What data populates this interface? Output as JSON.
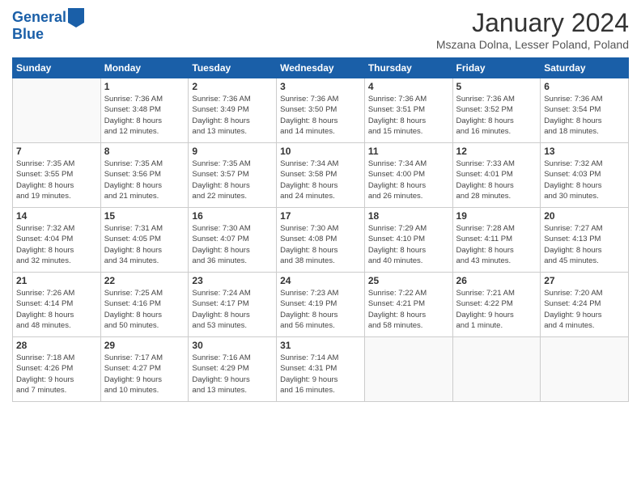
{
  "header": {
    "logo_line1": "General",
    "logo_line2": "Blue",
    "title": "January 2024",
    "location": "Mszana Dolna, Lesser Poland, Poland"
  },
  "weekdays": [
    "Sunday",
    "Monday",
    "Tuesday",
    "Wednesday",
    "Thursday",
    "Friday",
    "Saturday"
  ],
  "weeks": [
    [
      {
        "day": "",
        "info": ""
      },
      {
        "day": "1",
        "info": "Sunrise: 7:36 AM\nSunset: 3:48 PM\nDaylight: 8 hours\nand 12 minutes."
      },
      {
        "day": "2",
        "info": "Sunrise: 7:36 AM\nSunset: 3:49 PM\nDaylight: 8 hours\nand 13 minutes."
      },
      {
        "day": "3",
        "info": "Sunrise: 7:36 AM\nSunset: 3:50 PM\nDaylight: 8 hours\nand 14 minutes."
      },
      {
        "day": "4",
        "info": "Sunrise: 7:36 AM\nSunset: 3:51 PM\nDaylight: 8 hours\nand 15 minutes."
      },
      {
        "day": "5",
        "info": "Sunrise: 7:36 AM\nSunset: 3:52 PM\nDaylight: 8 hours\nand 16 minutes."
      },
      {
        "day": "6",
        "info": "Sunrise: 7:36 AM\nSunset: 3:54 PM\nDaylight: 8 hours\nand 18 minutes."
      }
    ],
    [
      {
        "day": "7",
        "info": "Sunrise: 7:35 AM\nSunset: 3:55 PM\nDaylight: 8 hours\nand 19 minutes."
      },
      {
        "day": "8",
        "info": "Sunrise: 7:35 AM\nSunset: 3:56 PM\nDaylight: 8 hours\nand 21 minutes."
      },
      {
        "day": "9",
        "info": "Sunrise: 7:35 AM\nSunset: 3:57 PM\nDaylight: 8 hours\nand 22 minutes."
      },
      {
        "day": "10",
        "info": "Sunrise: 7:34 AM\nSunset: 3:58 PM\nDaylight: 8 hours\nand 24 minutes."
      },
      {
        "day": "11",
        "info": "Sunrise: 7:34 AM\nSunset: 4:00 PM\nDaylight: 8 hours\nand 26 minutes."
      },
      {
        "day": "12",
        "info": "Sunrise: 7:33 AM\nSunset: 4:01 PM\nDaylight: 8 hours\nand 28 minutes."
      },
      {
        "day": "13",
        "info": "Sunrise: 7:32 AM\nSunset: 4:03 PM\nDaylight: 8 hours\nand 30 minutes."
      }
    ],
    [
      {
        "day": "14",
        "info": "Sunrise: 7:32 AM\nSunset: 4:04 PM\nDaylight: 8 hours\nand 32 minutes."
      },
      {
        "day": "15",
        "info": "Sunrise: 7:31 AM\nSunset: 4:05 PM\nDaylight: 8 hours\nand 34 minutes."
      },
      {
        "day": "16",
        "info": "Sunrise: 7:30 AM\nSunset: 4:07 PM\nDaylight: 8 hours\nand 36 minutes."
      },
      {
        "day": "17",
        "info": "Sunrise: 7:30 AM\nSunset: 4:08 PM\nDaylight: 8 hours\nand 38 minutes."
      },
      {
        "day": "18",
        "info": "Sunrise: 7:29 AM\nSunset: 4:10 PM\nDaylight: 8 hours\nand 40 minutes."
      },
      {
        "day": "19",
        "info": "Sunrise: 7:28 AM\nSunset: 4:11 PM\nDaylight: 8 hours\nand 43 minutes."
      },
      {
        "day": "20",
        "info": "Sunrise: 7:27 AM\nSunset: 4:13 PM\nDaylight: 8 hours\nand 45 minutes."
      }
    ],
    [
      {
        "day": "21",
        "info": "Sunrise: 7:26 AM\nSunset: 4:14 PM\nDaylight: 8 hours\nand 48 minutes."
      },
      {
        "day": "22",
        "info": "Sunrise: 7:25 AM\nSunset: 4:16 PM\nDaylight: 8 hours\nand 50 minutes."
      },
      {
        "day": "23",
        "info": "Sunrise: 7:24 AM\nSunset: 4:17 PM\nDaylight: 8 hours\nand 53 minutes."
      },
      {
        "day": "24",
        "info": "Sunrise: 7:23 AM\nSunset: 4:19 PM\nDaylight: 8 hours\nand 56 minutes."
      },
      {
        "day": "25",
        "info": "Sunrise: 7:22 AM\nSunset: 4:21 PM\nDaylight: 8 hours\nand 58 minutes."
      },
      {
        "day": "26",
        "info": "Sunrise: 7:21 AM\nSunset: 4:22 PM\nDaylight: 9 hours\nand 1 minute."
      },
      {
        "day": "27",
        "info": "Sunrise: 7:20 AM\nSunset: 4:24 PM\nDaylight: 9 hours\nand 4 minutes."
      }
    ],
    [
      {
        "day": "28",
        "info": "Sunrise: 7:18 AM\nSunset: 4:26 PM\nDaylight: 9 hours\nand 7 minutes."
      },
      {
        "day": "29",
        "info": "Sunrise: 7:17 AM\nSunset: 4:27 PM\nDaylight: 9 hours\nand 10 minutes."
      },
      {
        "day": "30",
        "info": "Sunrise: 7:16 AM\nSunset: 4:29 PM\nDaylight: 9 hours\nand 13 minutes."
      },
      {
        "day": "31",
        "info": "Sunrise: 7:14 AM\nSunset: 4:31 PM\nDaylight: 9 hours\nand 16 minutes."
      },
      {
        "day": "",
        "info": ""
      },
      {
        "day": "",
        "info": ""
      },
      {
        "day": "",
        "info": ""
      }
    ]
  ]
}
